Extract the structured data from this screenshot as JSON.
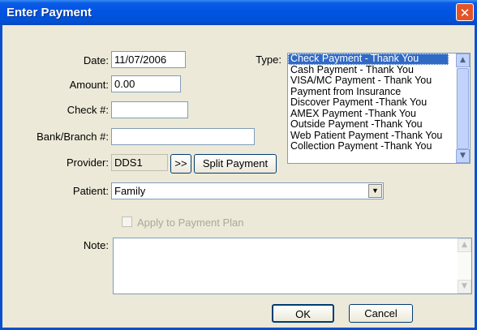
{
  "window": {
    "title": "Enter Payment",
    "close_label": "✕"
  },
  "form": {
    "date_label": "Date:",
    "date_value": "11/07/2006",
    "amount_label": "Amount:",
    "amount_value": "0.00",
    "check_label": "Check #:",
    "check_value": "",
    "bank_label": "Bank/Branch #:",
    "bank_value": "",
    "provider_label": "Provider:",
    "provider_value": "DDS1",
    "provider_more_label": ">>",
    "split_payment_label": "Split Payment",
    "patient_label": "Patient:",
    "patient_value": "Family",
    "apply_plan_label": "Apply to Payment Plan",
    "note_label": "Note:",
    "note_value": "",
    "type_label": "Type:"
  },
  "type_list": {
    "items": [
      "Check Payment - Thank You",
      "Cash Payment - Thank You",
      "VISA/MC Payment - Thank You",
      "Payment from Insurance",
      "Discover Payment -Thank You",
      "AMEX Payment -Thank You",
      "Outside Payment -Thank You",
      "Web Patient Payment -Thank You",
      "Collection Payment -Thank You"
    ],
    "selected_index": 0
  },
  "buttons": {
    "ok_label": "OK",
    "cancel_label": "Cancel"
  },
  "icons": {
    "close": "close-icon",
    "dropdown": "chevron-down-icon",
    "scroll_up": "arrow-up-icon",
    "scroll_down": "arrow-down-icon"
  },
  "colors": {
    "title_bar": "#0054e3",
    "selection": "#316ac5",
    "dialog_bg": "#ece9d8"
  }
}
